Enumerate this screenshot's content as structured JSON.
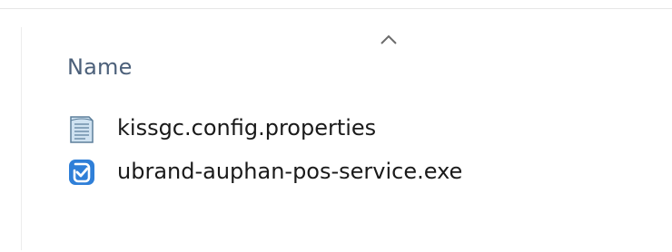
{
  "header": {
    "column_name": "Name",
    "sort_direction": "ascending"
  },
  "files": [
    {
      "name": "kissgc.config.properties",
      "icon": "text-file-icon"
    },
    {
      "name": "ubrand-auphan-pos-service.exe",
      "icon": "exe-app-icon"
    }
  ],
  "colors": {
    "header_text": "#4c607a",
    "file_text": "#1a1a1a",
    "exe_icon_blue": "#2f7fd8"
  }
}
